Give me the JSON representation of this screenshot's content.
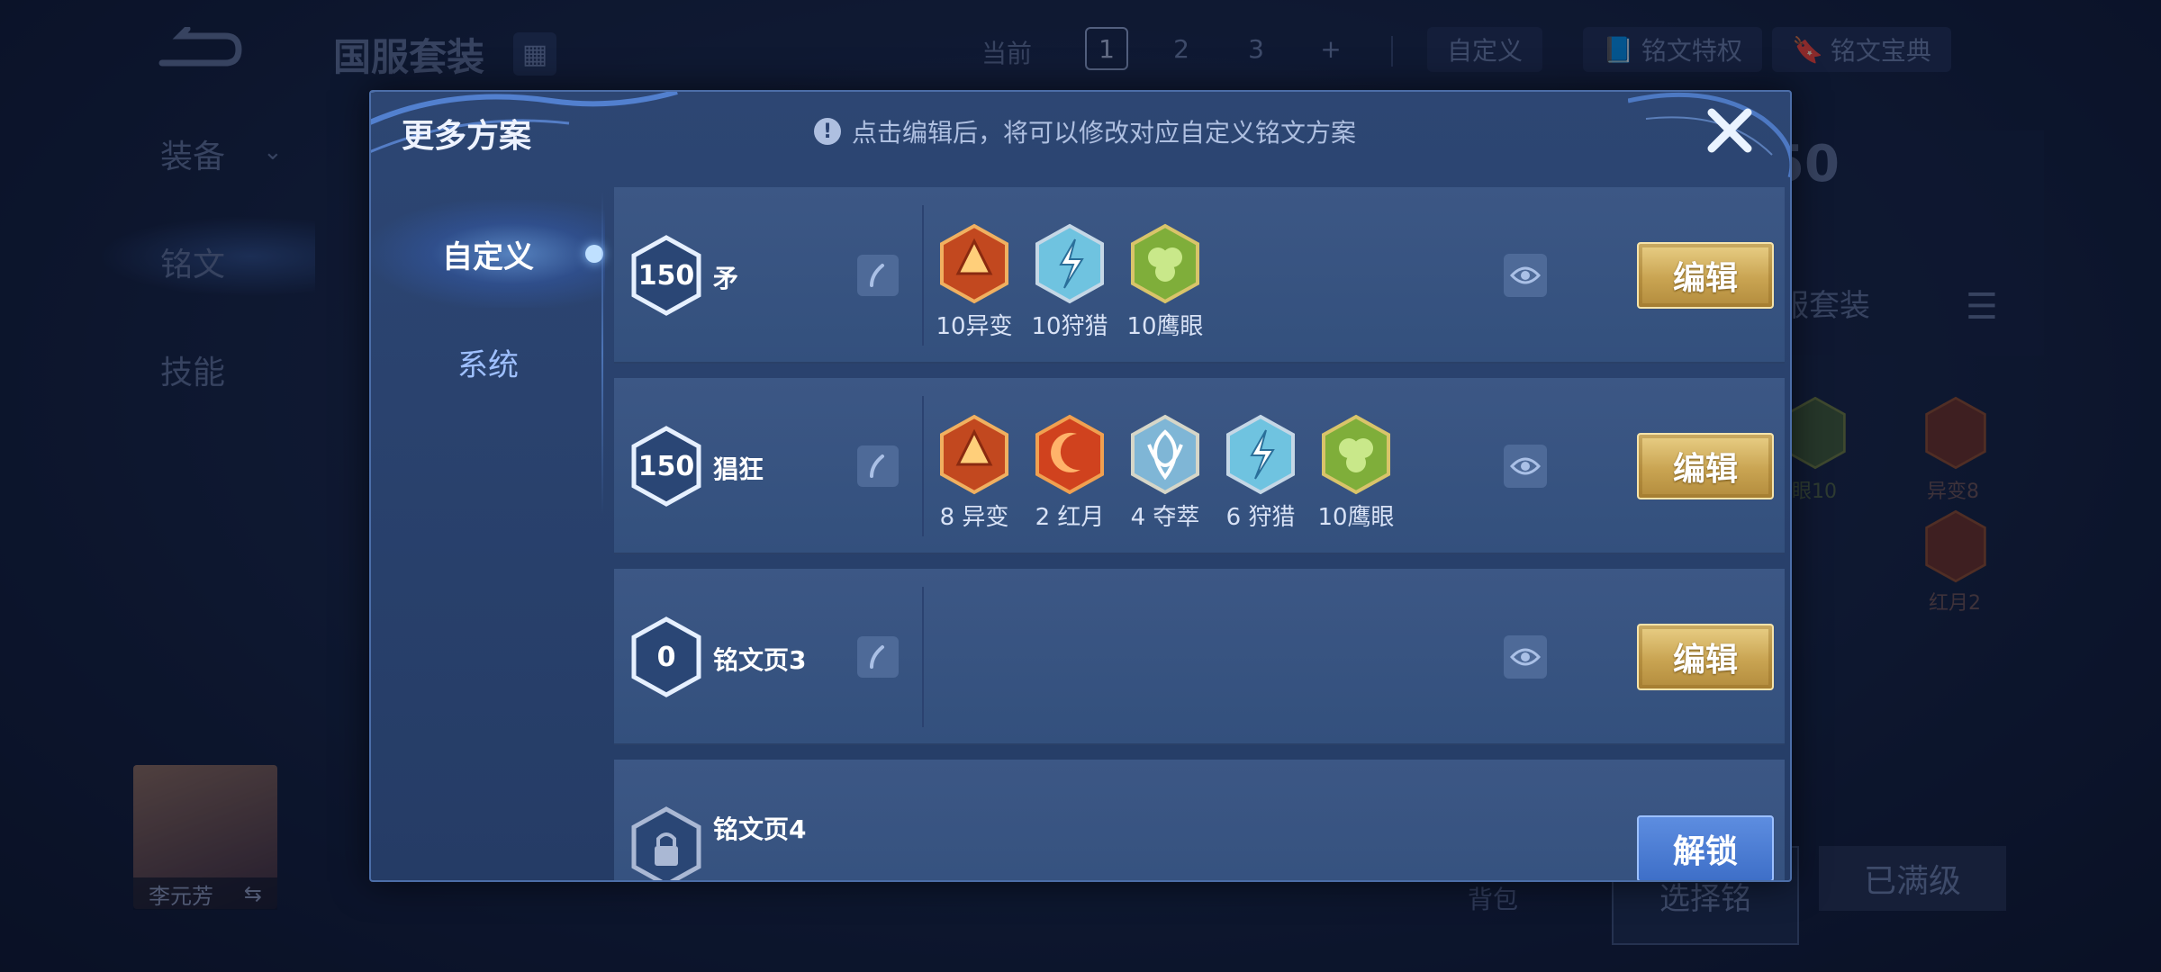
{
  "background": {
    "title": "国服套装",
    "current_label": "当前",
    "pages": [
      "1",
      "2",
      "3",
      "+"
    ],
    "custom_label": "自定义",
    "privilege_label": "铭文特权",
    "codex_label": "铭文宝典",
    "nav": [
      "装备",
      "铭文",
      "技能"
    ],
    "hero_name": "李元芳",
    "swap_symbol": "⇆",
    "level_badge": "50",
    "set_label": "服套装",
    "side_runes": [
      {
        "label": "眼10",
        "color": "#4f7a3a"
      },
      {
        "label": "异变8",
        "color": "#8a3a2a"
      },
      {
        "label": "红月2",
        "color": "#8a3a2a"
      }
    ],
    "bag_label": "背包",
    "btn_left": "选择铭",
    "btn_right": "已满级"
  },
  "modal": {
    "title": "更多方案",
    "hint_icon": "!",
    "hint": "点击编辑后，将可以修改对应自定义铭文方案",
    "tabs": [
      {
        "label": "自定义",
        "active": true
      },
      {
        "label": "系统",
        "active": false
      }
    ],
    "rows": [
      {
        "level": "150",
        "name": "矛",
        "runes": [
          {
            "type": "yibian",
            "label": "10异变"
          },
          {
            "type": "shoulie",
            "label": "10狩猎"
          },
          {
            "type": "yingyan",
            "label": "10鹰眼"
          }
        ],
        "action": "编辑"
      },
      {
        "level": "150",
        "name": "猖狂",
        "runes": [
          {
            "type": "yibian",
            "label": "8 异变"
          },
          {
            "type": "hongyue",
            "label": "2 红月"
          },
          {
            "type": "duocui",
            "label": "4 夺萃"
          },
          {
            "type": "shoulie",
            "label": "6 狩猎"
          },
          {
            "type": "yingyan",
            "label": "10鹰眼"
          }
        ],
        "action": "编辑"
      },
      {
        "level": "0",
        "name": "铭文页3",
        "runes": [],
        "action": "编辑"
      },
      {
        "level": "",
        "name": "铭文页4",
        "runes": [],
        "action": "解锁",
        "locked": true
      }
    ]
  },
  "colors": {
    "edit_gold": "#c9a452",
    "unlock_blue": "#3e6fc8",
    "tab_active": "#ffffff",
    "tab_inactive": "#9fc0ff"
  }
}
